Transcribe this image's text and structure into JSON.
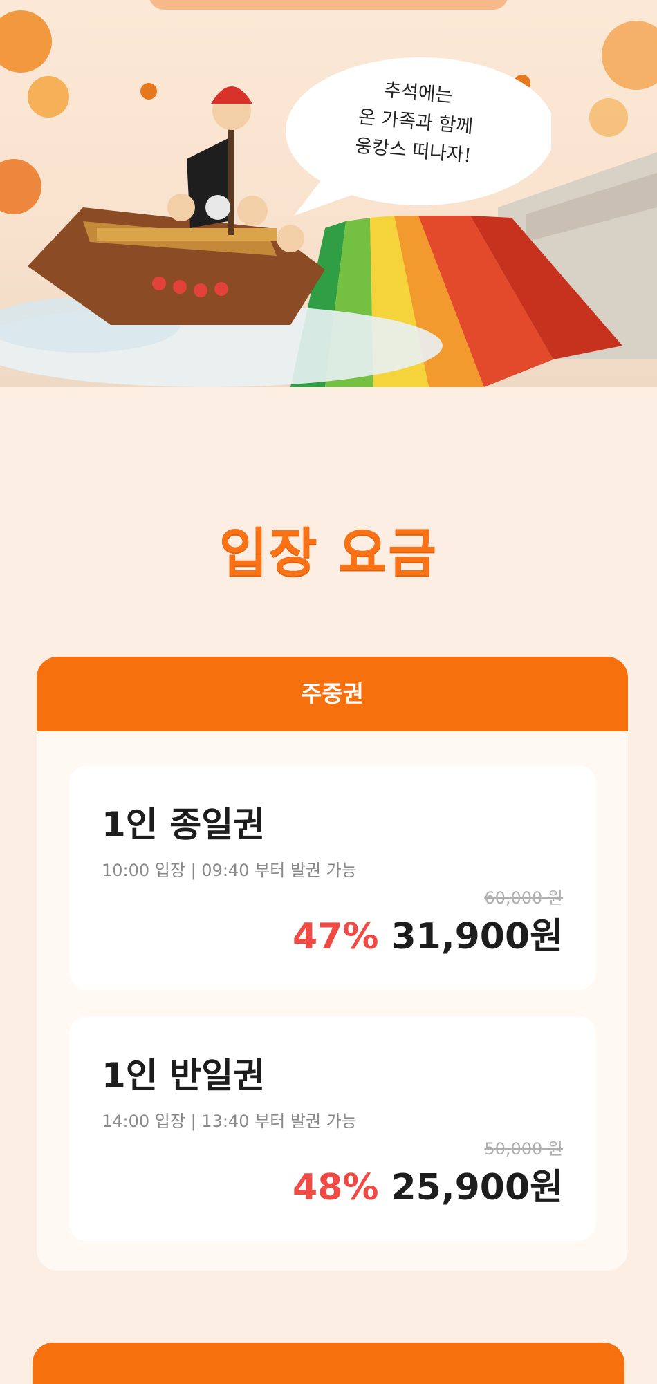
{
  "hero": {
    "speech_bubble": "추석에는\n온 가족과 함께\n웅캉스 떠나자!"
  },
  "pricing": {
    "title": "입장 요금",
    "category": "주중권",
    "tickets": [
      {
        "name": "1인 종일권",
        "description": "10:00 입장 | 09:40 부터 발권 가능",
        "original_price": "60,000 원",
        "discount": "47%",
        "price": "31,900원"
      },
      {
        "name": "1인 반일권",
        "description": "14:00 입장 | 13:40 부터 발권 가능",
        "original_price": "50,000 원",
        "discount": "48%",
        "price": "25,900원"
      }
    ]
  },
  "colors": {
    "accent": "#f7700e",
    "discount": "#ef4b44",
    "background": "#fdeee4"
  }
}
